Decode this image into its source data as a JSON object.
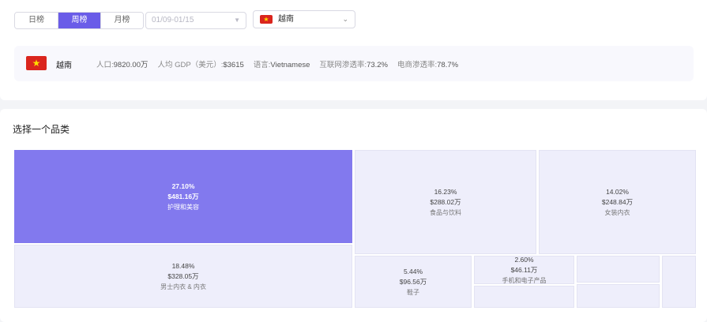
{
  "tabs": [
    {
      "label": "日榜",
      "active": false
    },
    {
      "label": "周榜",
      "active": true
    },
    {
      "label": "月榜",
      "active": false
    }
  ],
  "date_range": {
    "placeholder": "01/09-01/15"
  },
  "country_select": {
    "value": "越南",
    "flag": "vietnam-flag-icon"
  },
  "info": {
    "country": "越南",
    "stats": [
      {
        "label": "人口:",
        "value": "9820.00万"
      },
      {
        "label": "人均 GDP（美元）:",
        "value": "$3615"
      },
      {
        "label": "语言:",
        "value": "Vietnamese"
      },
      {
        "label": "互联网渗透率:",
        "value": "73.2%"
      },
      {
        "label": "电商渗透率:",
        "value": "78.7%"
      }
    ]
  },
  "section_title": "选择一个品类",
  "colors": {
    "accent": "#6a5ce8",
    "tile_active": "#8279ee",
    "tile": "#eeeefb",
    "flag_red": "#da251d",
    "flag_star": "#ffde00"
  },
  "treemap": [
    {
      "pct": "27.10%",
      "amount": "$481.16万",
      "name": "护理和美容",
      "active": true
    },
    {
      "pct": "16.23%",
      "amount": "$288.02万",
      "name": "食品与饮料",
      "active": false
    },
    {
      "pct": "14.02%",
      "amount": "$248.84万",
      "name": "女装内衣",
      "active": false
    },
    {
      "pct": "18.48%",
      "amount": "$328.05万",
      "name": "男士内衣 & 内衣",
      "active": false
    },
    {
      "pct": "5.44%",
      "amount": "$96.56万",
      "name": "鞋子",
      "active": false
    },
    {
      "pct": "2.60%",
      "amount": "$46.11万",
      "name": "手机和电子产品",
      "active": false
    },
    {
      "pct": "",
      "amount": "",
      "name": "",
      "active": false
    },
    {
      "pct": "",
      "amount": "",
      "name": "",
      "active": false
    },
    {
      "pct": "",
      "amount": "",
      "name": "",
      "active": false
    },
    {
      "pct": "",
      "amount": "",
      "name": "",
      "active": false
    }
  ]
}
